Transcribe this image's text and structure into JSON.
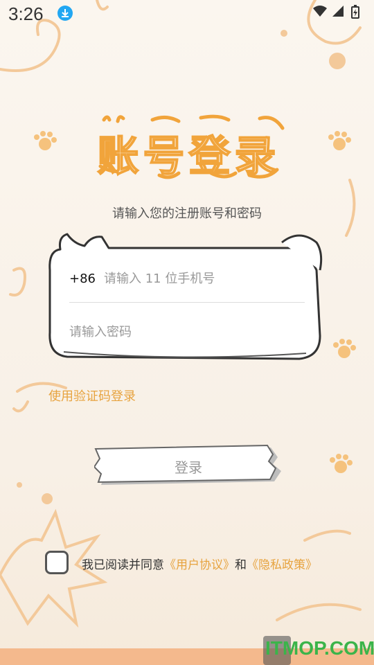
{
  "status": {
    "time": "3:26"
  },
  "page": {
    "title": "账号登录",
    "subtitle": "请输入您的注册账号和密码",
    "phone": {
      "country_code": "+86",
      "placeholder": "请输入 11 位手机号"
    },
    "password": {
      "placeholder": "请输入密码"
    },
    "sms_login_label": "使用验证码登录",
    "login_button": "登录",
    "agreement": {
      "prefix": "我已阅读并同意",
      "user_agreement": "《用户协议》",
      "and": "和",
      "privacy_policy": "《隐私政策》",
      "checked": false
    }
  },
  "watermark": "ITMOP.COM",
  "colors": {
    "accent": "#e7a33f",
    "title_stroke": "#f1a43b",
    "status_download": "#22a7f2"
  },
  "icons": [
    "download-icon",
    "wifi-icon",
    "signal-icon",
    "battery-icon",
    "paw-icon",
    "checkbox-icon"
  ]
}
